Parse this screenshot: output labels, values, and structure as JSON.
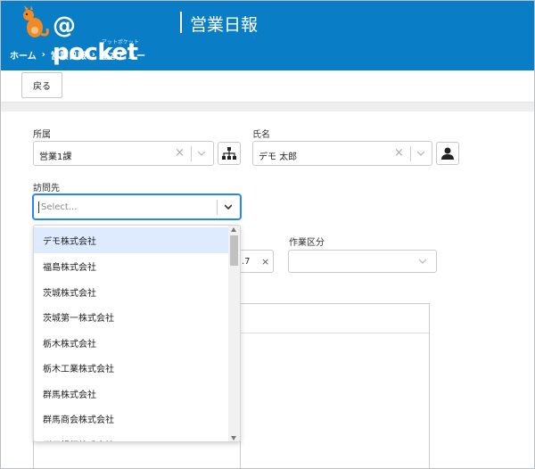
{
  "header": {
    "logo_text": "@ pocket",
    "logo_sub": "アットポケット",
    "app_title": "営業日報",
    "breadcrumb": [
      "ホーム",
      "営業日報",
      "基本ビュー"
    ]
  },
  "toolbar": {
    "back_label": "戻る"
  },
  "form": {
    "department_label": "所属",
    "department_value": "営業1課",
    "name_label": "氏名",
    "name_value": "デモ 太郎",
    "visit_label": "訪問先",
    "visit_placeholder": "Select...",
    "work_type_label": "作業区分",
    "date_value_partial": ".7"
  },
  "dropdown": {
    "options": [
      "デモ株式会社",
      "福島株式会社",
      "茨城株式会社",
      "茨城第一株式会社",
      "栃木株式会社",
      "栃木工業株式会社",
      "群馬株式会社",
      "群馬商会株式会社",
      "群馬銀行株式会社"
    ],
    "highlighted_index": 0
  },
  "colors": {
    "header": "#0a7dc7",
    "focus": "#2684ff",
    "highlight": "#deebff"
  }
}
